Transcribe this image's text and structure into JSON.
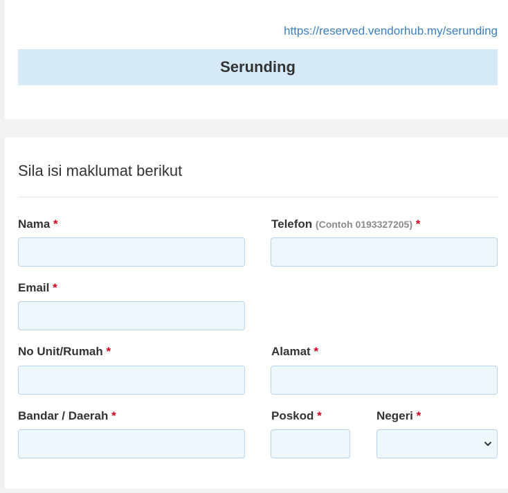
{
  "header": {
    "url": "https://reserved.vendorhub.my/serunding",
    "title": "Serunding"
  },
  "form": {
    "heading": "Sila isi maklumat berikut",
    "required_marker": "*",
    "fields": {
      "nama": {
        "label": "Nama",
        "value": ""
      },
      "telefon": {
        "label": "Telefon",
        "hint": "(Contoh 0193327205)",
        "value": ""
      },
      "email": {
        "label": "Email",
        "value": ""
      },
      "no_unit": {
        "label": "No Unit/Rumah",
        "value": ""
      },
      "alamat": {
        "label": "Alamat",
        "value": ""
      },
      "bandar": {
        "label": "Bandar / Daerah",
        "value": ""
      },
      "poskod": {
        "label": "Poskod",
        "value": ""
      },
      "negeri": {
        "label": "Negeri",
        "selected": ""
      }
    }
  },
  "colors": {
    "link": "#3a7fc0",
    "banner": "#d6e9f7",
    "input_bg": "#eef6fe",
    "input_border": "#b8d4ec",
    "required": "#d0021b"
  },
  "icons": {
    "negeri_dropdown": "chevron-down-icon"
  }
}
